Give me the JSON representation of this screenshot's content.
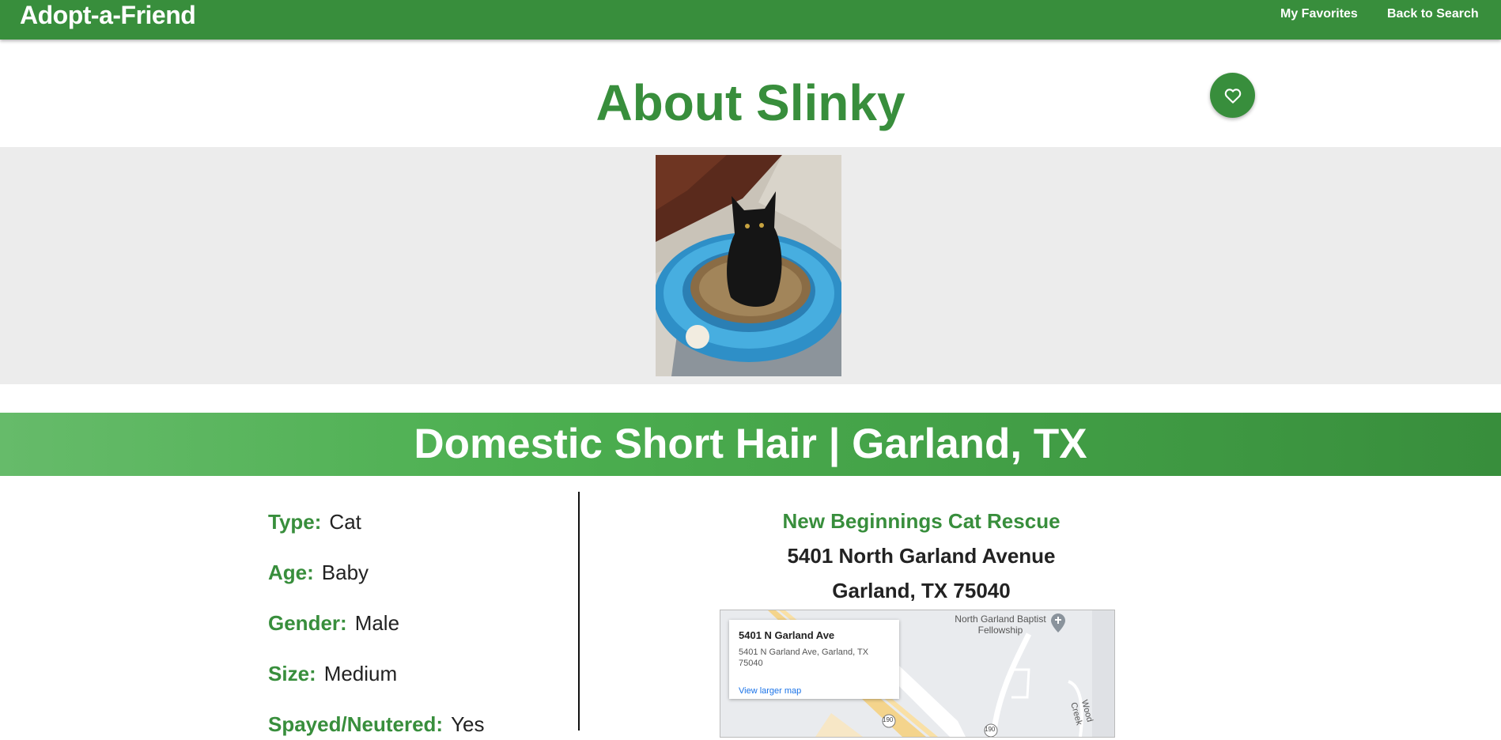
{
  "nav": {
    "brand": "Adopt-a-Friend",
    "favorites": "My Favorites",
    "back": "Back to Search"
  },
  "pet": {
    "title": "About Slinky",
    "photo_alt": "Black kitten sitting on a blue scratcher toy",
    "banner": "Domestic Short Hair | Garland, TX",
    "attributes": [
      {
        "label": "Type:",
        "value": "Cat"
      },
      {
        "label": "Age:",
        "value": "Baby"
      },
      {
        "label": "Gender:",
        "value": "Male"
      },
      {
        "label": "Size:",
        "value": "Medium"
      },
      {
        "label": "Spayed/Neutered:",
        "value": "Yes"
      }
    ]
  },
  "organization": {
    "name": "New Beginnings Cat Rescue",
    "street": "5401 North Garland Avenue",
    "city": "Garland, TX 75040"
  },
  "map": {
    "place_title": "5401 N Garland Ave",
    "place_address": "5401 N Garland Ave, Garland, TX 75040",
    "larger_map": "View larger map",
    "poi": "North Garland Baptist Fellowship",
    "road_label": "Wood Creek",
    "route_a": "190",
    "route_b": "190"
  },
  "colors": {
    "primary": "#388e3c",
    "banner_light": "#66bb6a",
    "photo_band": "#ececec"
  },
  "icons": {
    "favorite": "heart-outline-icon",
    "poi": "church-pin-icon"
  }
}
